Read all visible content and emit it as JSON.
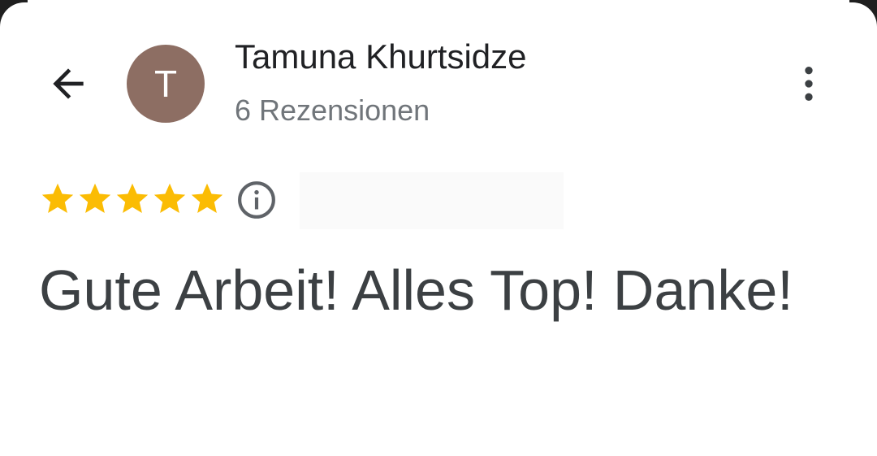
{
  "header": {
    "back_icon": "arrow-left-icon",
    "avatar_initial": "T",
    "avatar_color": "#8d6e63",
    "reviewer_name": "Tamuna Khurtsidze",
    "review_count": "6 Rezensionen",
    "more_icon": "more-vert-icon"
  },
  "review": {
    "rating": 5,
    "max_rating": 5,
    "star_color": "#fbbc04",
    "info_icon": "info-icon",
    "text": "Gute Arbeit! Alles Top! Danke!"
  }
}
